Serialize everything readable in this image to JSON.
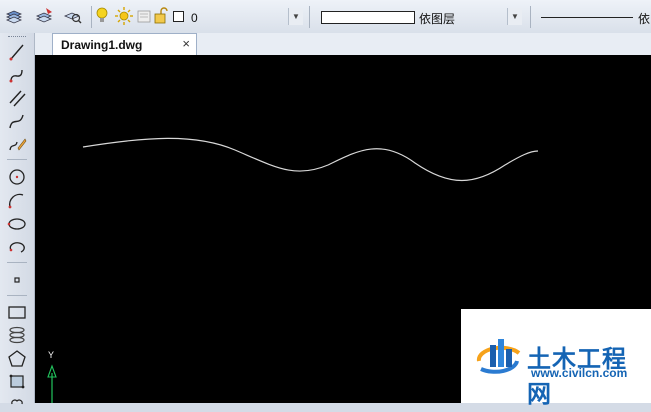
{
  "toolbar": {
    "layer_name": "0",
    "color_value": "依图层",
    "linetype_value": "依"
  },
  "drawing_tab": {
    "label": "Drawing1.dwg",
    "close_glyph": "×"
  },
  "canvas": {
    "background": "#000000",
    "curve_color": "#d8d8d8",
    "ucs_axis_label": "Y",
    "ucs_color": "#22c55e"
  },
  "watermark": {
    "title": "土木工程网",
    "url": "www.civilcn.com"
  }
}
